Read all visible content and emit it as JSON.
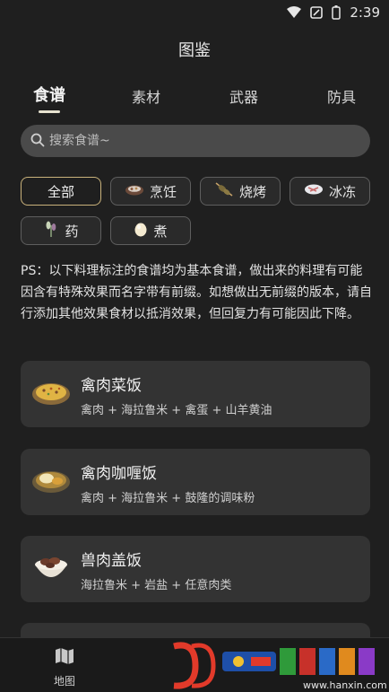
{
  "status": {
    "time": "2:39"
  },
  "header": {
    "title": "图鉴"
  },
  "tabs": [
    {
      "label": "食谱",
      "active": true
    },
    {
      "label": "素材"
    },
    {
      "label": "武器"
    },
    {
      "label": "防具"
    }
  ],
  "search": {
    "placeholder": "搜索食谱~"
  },
  "filters": [
    {
      "label": "全部",
      "active": true
    },
    {
      "label": "烹饪",
      "icon": "cooking-pot-icon"
    },
    {
      "label": "烧烤",
      "icon": "skewer-icon"
    },
    {
      "label": "冰冻",
      "icon": "frozen-fish-icon"
    },
    {
      "label": "药",
      "icon": "herb-icon"
    },
    {
      "label": "煮",
      "icon": "boiled-egg-icon"
    }
  ],
  "note": "PS：以下料理标注的食谱均为基本食谱，做出来的料理有可能因含有特殊效果而名字带有前缀。如想做出无前缀的版本，请自行添加其他效果食材以抵消效果，但回复力有可能因此下降。",
  "recipes": [
    {
      "name": "禽肉菜饭",
      "ingredients": "禽肉 + 海拉鲁米 + 禽蛋 + 山羊黄油",
      "icon": "fried-rice-dish-icon"
    },
    {
      "name": "禽肉咖喱饭",
      "ingredients": "禽肉 + 海拉鲁米 + 鼓隆的调味粉",
      "icon": "curry-rice-dish-icon"
    },
    {
      "name": "兽肉盖饭",
      "ingredients": "海拉鲁米 + 岩盐 + 任意肉类",
      "icon": "meat-bowl-dish-icon"
    }
  ],
  "bottom_nav": [
    {
      "label": "地图",
      "icon": "map-icon"
    }
  ],
  "watermark": {
    "text": "www.hanxin.com"
  },
  "colors": {
    "accent": "#c9b27b",
    "card": "#333333",
    "background": "#1f1f1f"
  }
}
